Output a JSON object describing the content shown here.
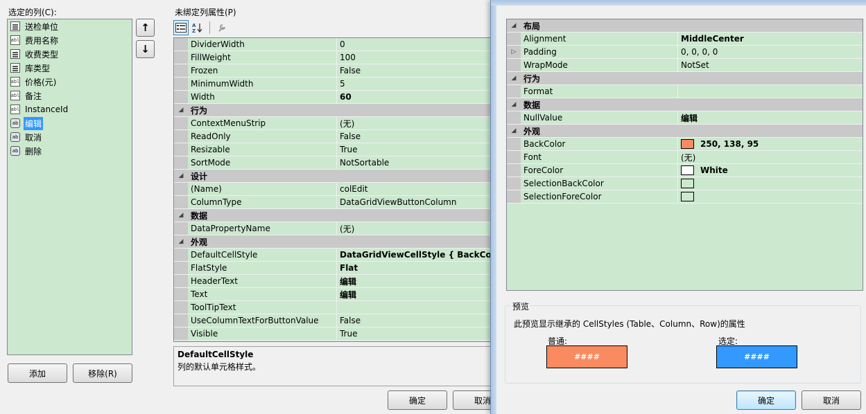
{
  "left": {
    "columns_label": "选定的列(C):",
    "columns": [
      {
        "icon": "combo",
        "label": "送检单位",
        "selected": false
      },
      {
        "icon": "text",
        "label": "费用名称",
        "selected": false
      },
      {
        "icon": "combo",
        "label": "收费类型",
        "selected": false
      },
      {
        "icon": "combo",
        "label": "库类型",
        "selected": false
      },
      {
        "icon": "text",
        "label": "价格(元)",
        "selected": false
      },
      {
        "icon": "text",
        "label": "备注",
        "selected": false
      },
      {
        "icon": "text",
        "label": "InstanceId",
        "selected": false
      },
      {
        "icon": "button",
        "label": "编辑",
        "selected": true
      },
      {
        "icon": "button",
        "label": "取消",
        "selected": false
      },
      {
        "icon": "button",
        "label": "删除",
        "selected": false
      }
    ],
    "add_label": "添加",
    "remove_label": "移除(R)",
    "move_up": "↑",
    "move_down": "↓"
  },
  "props": {
    "title": "未绑定列属性(P)",
    "rows": [
      {
        "name": "DividerWidth",
        "value": "0",
        "bold": false
      },
      {
        "name": "FillWeight",
        "value": "100",
        "bold": false
      },
      {
        "name": "Frozen",
        "value": "False",
        "bold": false
      },
      {
        "name": "MinimumWidth",
        "value": "5",
        "bold": false
      },
      {
        "name": "Width",
        "value": "60",
        "bold": true
      },
      {
        "cat": "行为"
      },
      {
        "name": "ContextMenuStrip",
        "value": "(无)",
        "bold": false
      },
      {
        "name": "ReadOnly",
        "value": "False",
        "bold": false
      },
      {
        "name": "Resizable",
        "value": "True",
        "bold": false
      },
      {
        "name": "SortMode",
        "value": "NotSortable",
        "bold": false
      },
      {
        "cat": "设计"
      },
      {
        "name": "(Name)",
        "value": "colEdit",
        "bold": false
      },
      {
        "name": "ColumnType",
        "value": "DataGridViewButtonColumn",
        "bold": false
      },
      {
        "cat": "数据"
      },
      {
        "name": "DataPropertyName",
        "value": "(无)",
        "bold": false
      },
      {
        "cat": "外观"
      },
      {
        "name": "DefaultCellStyle",
        "value": "DataGridViewCellStyle { BackColor=",
        "bold": true
      },
      {
        "name": "FlatStyle",
        "value": "Flat",
        "bold": true
      },
      {
        "name": "HeaderText",
        "value": "编辑",
        "bold": true
      },
      {
        "name": "Text",
        "value": "编辑",
        "bold": true
      },
      {
        "name": "ToolTipText",
        "value": "",
        "bold": false
      },
      {
        "name": "UseColumnTextForButtonValue",
        "value": "False",
        "bold": false
      },
      {
        "name": "Visible",
        "value": "True",
        "bold": false
      }
    ],
    "desc_title": "DefaultCellStyle",
    "desc_text": "列的默认单元格样式。"
  },
  "buttons": {
    "ok": "确定",
    "cancel": "取消"
  },
  "cellstyle": {
    "rows": [
      {
        "cat": "布局"
      },
      {
        "name": "Alignment",
        "value": "MiddleCenter",
        "bold": true
      },
      {
        "name": "Padding",
        "value": "0, 0, 0, 0",
        "bold": false,
        "expand": true
      },
      {
        "name": "WrapMode",
        "value": "NotSet",
        "bold": false
      },
      {
        "cat": "行为"
      },
      {
        "name": "Format",
        "value": "",
        "bold": false
      },
      {
        "cat": "数据"
      },
      {
        "name": "NullValue",
        "value": "编辑",
        "bold": true
      },
      {
        "cat": "外观"
      },
      {
        "name": "BackColor",
        "value": "250, 138, 95",
        "bold": true,
        "swatch": "#fa8a5f"
      },
      {
        "name": "Font",
        "value": "(无)",
        "bold": false
      },
      {
        "name": "ForeColor",
        "value": "White",
        "bold": true,
        "swatch": "#ffffff"
      },
      {
        "name": "SelectionBackColor",
        "value": "",
        "bold": false,
        "swatch": "#cce8cf"
      },
      {
        "name": "SelectionForeColor",
        "value": "",
        "bold": false,
        "swatch": "#cce8cf"
      }
    ],
    "preview_title": "预览",
    "preview_desc": "此预览显示继承的 CellStyles (Table、Column、Row)的属性",
    "normal_label": "普通:",
    "selected_label": "选定:",
    "normal_sample": "####",
    "selected_sample": "####",
    "normal_color": "#fa8a5f",
    "selected_color": "#3399ff"
  }
}
